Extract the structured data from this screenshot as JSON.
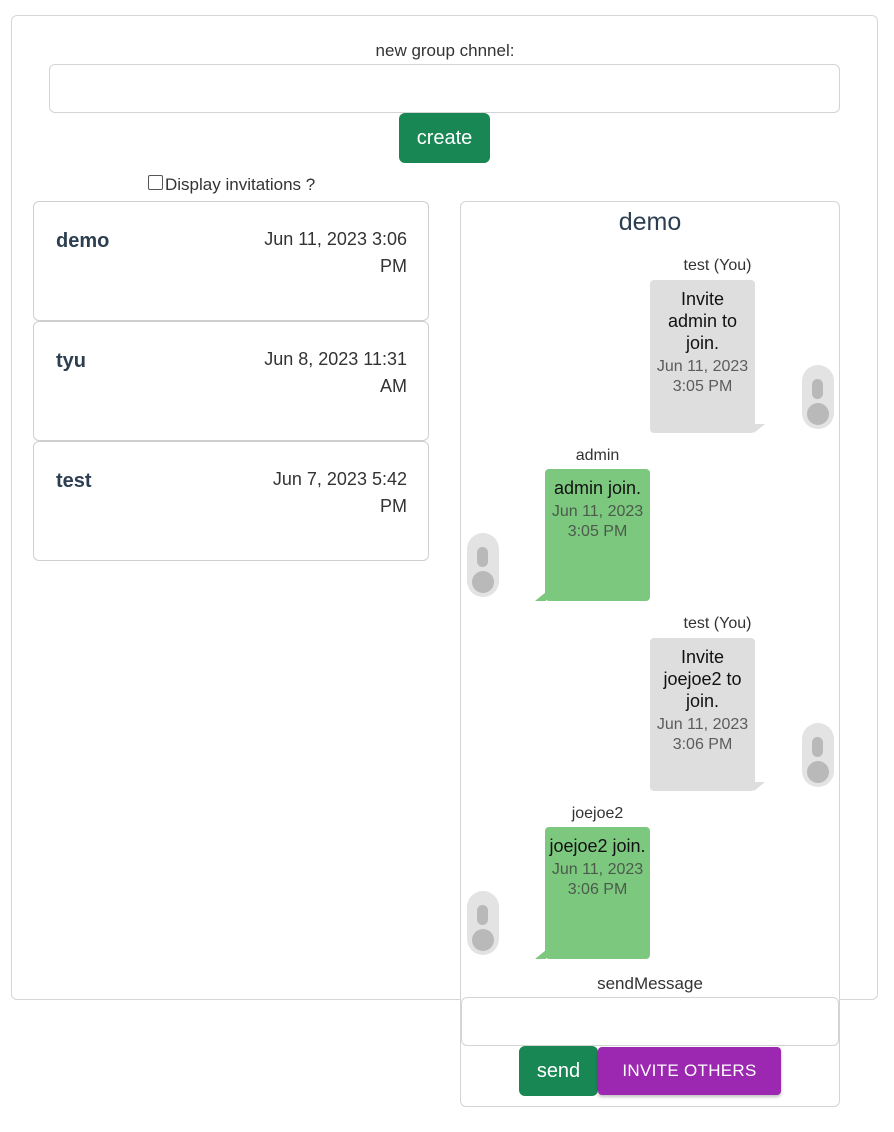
{
  "create_section": {
    "label": "new group chnnel:",
    "input_value": "",
    "create_label": "create"
  },
  "invitations_toggle": {
    "label": "Display invitations ?",
    "checked": false
  },
  "channels": [
    {
      "name": "demo",
      "date": "Jun 11, 2023 3:06 PM"
    },
    {
      "name": "tyu",
      "date": "Jun 8, 2023 11:31 AM"
    },
    {
      "name": "test",
      "date": "Jun 7, 2023 5:42 PM"
    }
  ],
  "chat": {
    "title": "demo",
    "messages": [
      {
        "sender": "test (You)",
        "text": "Invite admin to join.",
        "time": "Jun 11, 2023 3:05 PM",
        "mine": true
      },
      {
        "sender": "admin",
        "text": "admin join.",
        "time": "Jun 11, 2023 3:05 PM",
        "mine": false
      },
      {
        "sender": "test (You)",
        "text": "Invite joejoe2 to join.",
        "time": "Jun 11, 2023 3:06 PM",
        "mine": true
      },
      {
        "sender": "joejoe2",
        "text": "joejoe2 join.",
        "time": "Jun 11, 2023 3:06 PM",
        "mine": false
      }
    ],
    "composer": {
      "label": "sendMessage",
      "input_value": "",
      "send_label": "send",
      "invite_label": "INVITE OTHERS"
    }
  },
  "colors": {
    "primary_button": "#198754",
    "invite_button": "#9c27b0",
    "my_bubble": "#dedede",
    "their_bubble": "#7dc87f"
  }
}
